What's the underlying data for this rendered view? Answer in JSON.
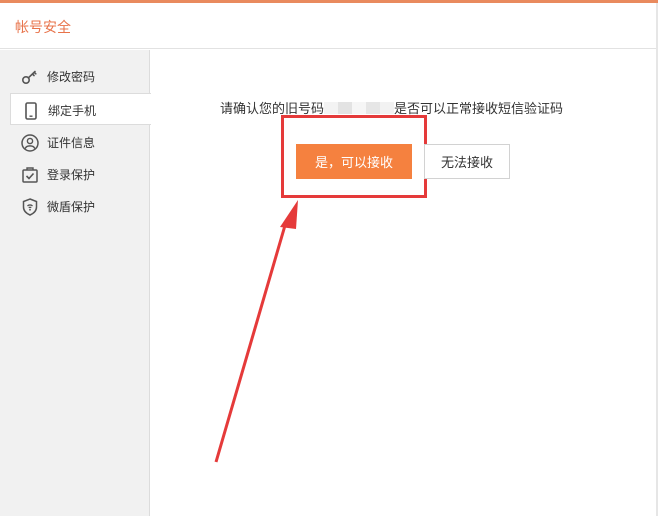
{
  "header": {
    "title": "帐号安全"
  },
  "sidebar": {
    "items": [
      {
        "label": "修改密码",
        "icon": "key-icon",
        "active": false
      },
      {
        "label": "绑定手机",
        "icon": "phone-icon",
        "active": true
      },
      {
        "label": "证件信息",
        "icon": "id-person-icon",
        "active": false
      },
      {
        "label": "登录保护",
        "icon": "login-check-icon",
        "active": false
      },
      {
        "label": "微盾保护",
        "icon": "shield-icon",
        "active": false
      }
    ]
  },
  "main": {
    "prompt_prefix": "请确认您的旧号码",
    "prompt_suffix": "是否可以正常接收短信验证码",
    "confirm_button": "是，可以接收",
    "reject_button": "无法接收"
  },
  "colors": {
    "accent": "#e8734a",
    "primary_button": "#f5813f",
    "annotation_red": "#e53a3a"
  }
}
